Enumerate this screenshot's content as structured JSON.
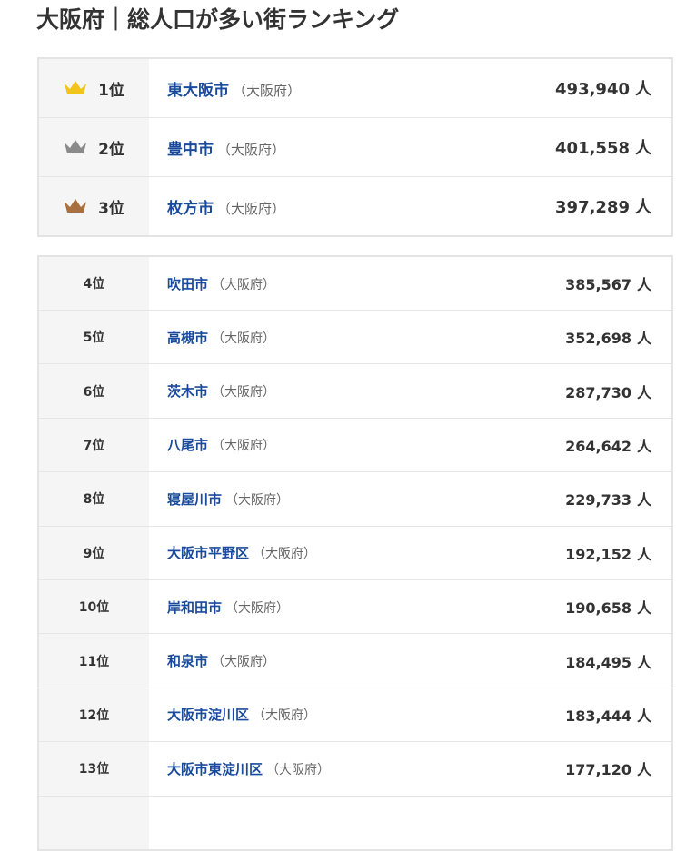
{
  "title": "大阪府｜総人口が多い街ランキング",
  "colors": {
    "link": "#1a4a9c",
    "gold": "#f0c419",
    "silver": "#8a8a8a",
    "bronze": "#a8703f"
  },
  "unit": "人",
  "top3": [
    {
      "rank": "1位",
      "city": "東大阪市",
      "pref": "（大阪府）",
      "population": "493,940",
      "crown": "gold-crown-icon"
    },
    {
      "rank": "2位",
      "city": "豊中市",
      "pref": "（大阪府）",
      "population": "401,558",
      "crown": "silver-crown-icon"
    },
    {
      "rank": "3位",
      "city": "枚方市",
      "pref": "（大阪府）",
      "population": "397,289",
      "crown": "bronze-crown-icon"
    }
  ],
  "rest": [
    {
      "rank": "4位",
      "city": "吹田市",
      "pref": "（大阪府）",
      "population": "385,567"
    },
    {
      "rank": "5位",
      "city": "高槻市",
      "pref": "（大阪府）",
      "population": "352,698"
    },
    {
      "rank": "6位",
      "city": "茨木市",
      "pref": "（大阪府）",
      "population": "287,730"
    },
    {
      "rank": "7位",
      "city": "八尾市",
      "pref": "（大阪府）",
      "population": "264,642"
    },
    {
      "rank": "8位",
      "city": "寝屋川市",
      "pref": "（大阪府）",
      "population": "229,733"
    },
    {
      "rank": "9位",
      "city": "大阪市平野区",
      "pref": "（大阪府）",
      "population": "192,152"
    },
    {
      "rank": "10位",
      "city": "岸和田市",
      "pref": "（大阪府）",
      "population": "190,658"
    },
    {
      "rank": "11位",
      "city": "和泉市",
      "pref": "（大阪府）",
      "population": "184,495"
    },
    {
      "rank": "12位",
      "city": "大阪市淀川区",
      "pref": "（大阪府）",
      "population": "183,444"
    },
    {
      "rank": "13位",
      "city": "大阪市東淀川区",
      "pref": "（大阪府）",
      "population": "177,120"
    }
  ]
}
